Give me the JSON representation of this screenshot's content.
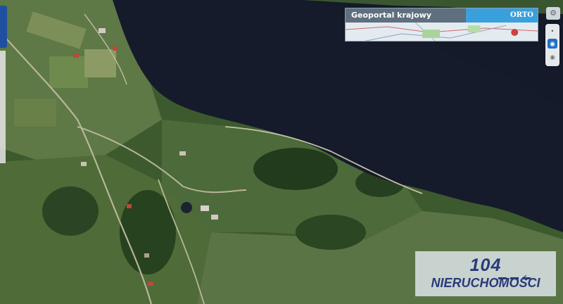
{
  "map": {
    "colors": {
      "water": "#141a2a",
      "forest": "#27401f",
      "meadow": "#5f7a45",
      "field": "#8a9a62",
      "road": "#b8b69a",
      "roof": "#b84a3a"
    }
  },
  "geoportal": {
    "title": "Geoportal krajowy",
    "layer_tab": "ORTO"
  },
  "controls": {
    "icons": [
      "settings-icon",
      "zoom-in-icon",
      "eye-icon",
      "eye-hidden-icon"
    ]
  },
  "watermark": {
    "number": "104",
    "name": "NIERUCHOMOŚCI"
  }
}
